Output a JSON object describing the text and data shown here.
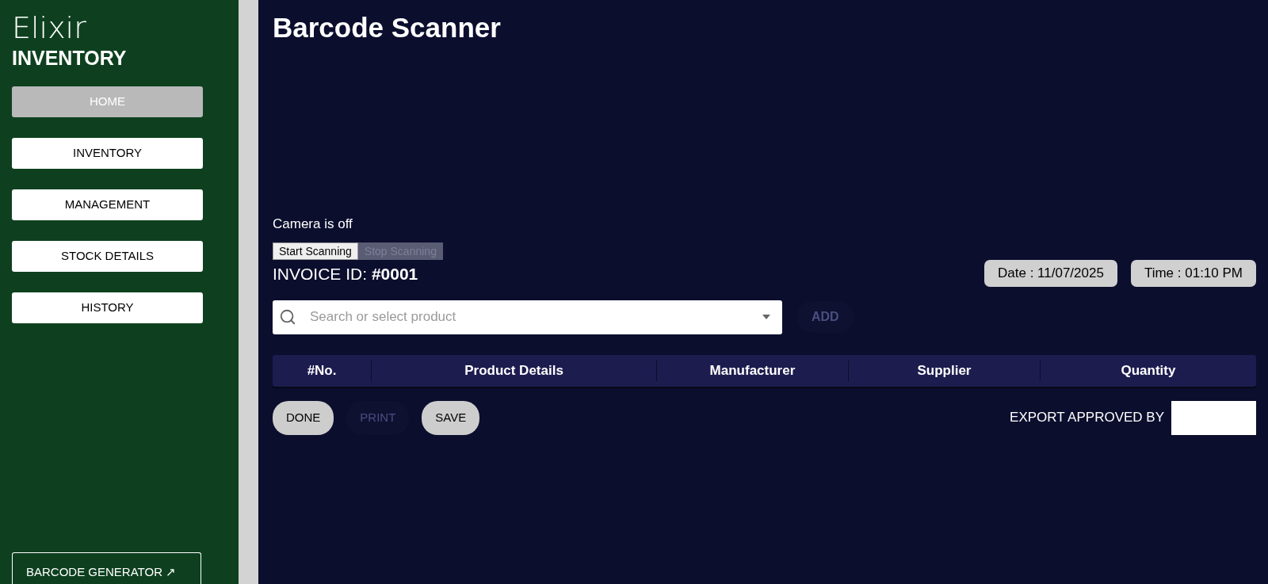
{
  "brand": {
    "name": "Elixir",
    "subtitle": "INVENTORY"
  },
  "nav": [
    {
      "label": "HOME",
      "selected": true
    },
    {
      "label": "INVENTORY",
      "selected": false
    },
    {
      "label": "MANAGEMENT",
      "selected": false
    },
    {
      "label": "STOCK DETAILS",
      "selected": false
    },
    {
      "label": "HISTORY",
      "selected": false
    }
  ],
  "external_link": {
    "label": "BARCODE GENERATOR ↗"
  },
  "title": "Barcode Scanner",
  "camera_status": "Camera is off",
  "scan_buttons": [
    {
      "label": "Start Scanning",
      "disabled": false
    },
    {
      "label": "Stop Scanning",
      "disabled": true
    }
  ],
  "invoice": {
    "label": "INVOICE ID:",
    "value": "#0001"
  },
  "date": "Date : 11/07/2025",
  "time": "Time : 01:10 PM",
  "search": {
    "placeholder": "Search or select product"
  },
  "add_button": {
    "label": "ADD",
    "disabled": true
  },
  "table": {
    "columns": [
      "#No.",
      "Product Details",
      "Manufacturer",
      "Supplier",
      "Quantity"
    ]
  },
  "actions": [
    {
      "label": "DONE",
      "disabled": false
    },
    {
      "label": "PRINT",
      "disabled": true
    },
    {
      "label": "SAVE",
      "disabled": false
    }
  ],
  "export": {
    "label": "EXPORT APPROVED BY"
  }
}
